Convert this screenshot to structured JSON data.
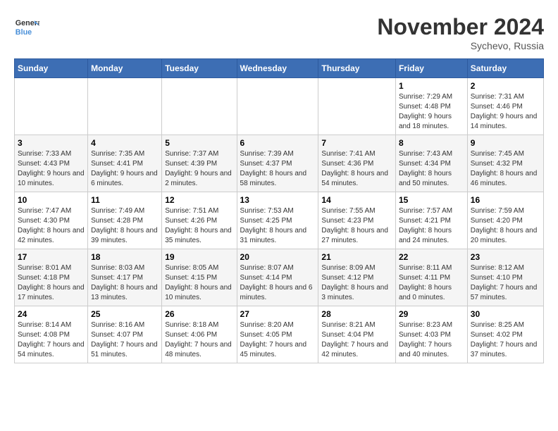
{
  "header": {
    "logo_line1": "General",
    "logo_line2": "Blue",
    "month": "November 2024",
    "location": "Sychevo, Russia"
  },
  "weekdays": [
    "Sunday",
    "Monday",
    "Tuesday",
    "Wednesday",
    "Thursday",
    "Friday",
    "Saturday"
  ],
  "weeks": [
    [
      {
        "day": "",
        "info": ""
      },
      {
        "day": "",
        "info": ""
      },
      {
        "day": "",
        "info": ""
      },
      {
        "day": "",
        "info": ""
      },
      {
        "day": "",
        "info": ""
      },
      {
        "day": "1",
        "info": "Sunrise: 7:29 AM\nSunset: 4:48 PM\nDaylight: 9 hours and 18 minutes."
      },
      {
        "day": "2",
        "info": "Sunrise: 7:31 AM\nSunset: 4:46 PM\nDaylight: 9 hours and 14 minutes."
      }
    ],
    [
      {
        "day": "3",
        "info": "Sunrise: 7:33 AM\nSunset: 4:43 PM\nDaylight: 9 hours and 10 minutes."
      },
      {
        "day": "4",
        "info": "Sunrise: 7:35 AM\nSunset: 4:41 PM\nDaylight: 9 hours and 6 minutes."
      },
      {
        "day": "5",
        "info": "Sunrise: 7:37 AM\nSunset: 4:39 PM\nDaylight: 9 hours and 2 minutes."
      },
      {
        "day": "6",
        "info": "Sunrise: 7:39 AM\nSunset: 4:37 PM\nDaylight: 8 hours and 58 minutes."
      },
      {
        "day": "7",
        "info": "Sunrise: 7:41 AM\nSunset: 4:36 PM\nDaylight: 8 hours and 54 minutes."
      },
      {
        "day": "8",
        "info": "Sunrise: 7:43 AM\nSunset: 4:34 PM\nDaylight: 8 hours and 50 minutes."
      },
      {
        "day": "9",
        "info": "Sunrise: 7:45 AM\nSunset: 4:32 PM\nDaylight: 8 hours and 46 minutes."
      }
    ],
    [
      {
        "day": "10",
        "info": "Sunrise: 7:47 AM\nSunset: 4:30 PM\nDaylight: 8 hours and 42 minutes."
      },
      {
        "day": "11",
        "info": "Sunrise: 7:49 AM\nSunset: 4:28 PM\nDaylight: 8 hours and 39 minutes."
      },
      {
        "day": "12",
        "info": "Sunrise: 7:51 AM\nSunset: 4:26 PM\nDaylight: 8 hours and 35 minutes."
      },
      {
        "day": "13",
        "info": "Sunrise: 7:53 AM\nSunset: 4:25 PM\nDaylight: 8 hours and 31 minutes."
      },
      {
        "day": "14",
        "info": "Sunrise: 7:55 AM\nSunset: 4:23 PM\nDaylight: 8 hours and 27 minutes."
      },
      {
        "day": "15",
        "info": "Sunrise: 7:57 AM\nSunset: 4:21 PM\nDaylight: 8 hours and 24 minutes."
      },
      {
        "day": "16",
        "info": "Sunrise: 7:59 AM\nSunset: 4:20 PM\nDaylight: 8 hours and 20 minutes."
      }
    ],
    [
      {
        "day": "17",
        "info": "Sunrise: 8:01 AM\nSunset: 4:18 PM\nDaylight: 8 hours and 17 minutes."
      },
      {
        "day": "18",
        "info": "Sunrise: 8:03 AM\nSunset: 4:17 PM\nDaylight: 8 hours and 13 minutes."
      },
      {
        "day": "19",
        "info": "Sunrise: 8:05 AM\nSunset: 4:15 PM\nDaylight: 8 hours and 10 minutes."
      },
      {
        "day": "20",
        "info": "Sunrise: 8:07 AM\nSunset: 4:14 PM\nDaylight: 8 hours and 6 minutes."
      },
      {
        "day": "21",
        "info": "Sunrise: 8:09 AM\nSunset: 4:12 PM\nDaylight: 8 hours and 3 minutes."
      },
      {
        "day": "22",
        "info": "Sunrise: 8:11 AM\nSunset: 4:11 PM\nDaylight: 8 hours and 0 minutes."
      },
      {
        "day": "23",
        "info": "Sunrise: 8:12 AM\nSunset: 4:10 PM\nDaylight: 7 hours and 57 minutes."
      }
    ],
    [
      {
        "day": "24",
        "info": "Sunrise: 8:14 AM\nSunset: 4:08 PM\nDaylight: 7 hours and 54 minutes."
      },
      {
        "day": "25",
        "info": "Sunrise: 8:16 AM\nSunset: 4:07 PM\nDaylight: 7 hours and 51 minutes."
      },
      {
        "day": "26",
        "info": "Sunrise: 8:18 AM\nSunset: 4:06 PM\nDaylight: 7 hours and 48 minutes."
      },
      {
        "day": "27",
        "info": "Sunrise: 8:20 AM\nSunset: 4:05 PM\nDaylight: 7 hours and 45 minutes."
      },
      {
        "day": "28",
        "info": "Sunrise: 8:21 AM\nSunset: 4:04 PM\nDaylight: 7 hours and 42 minutes."
      },
      {
        "day": "29",
        "info": "Sunrise: 8:23 AM\nSunset: 4:03 PM\nDaylight: 7 hours and 40 minutes."
      },
      {
        "day": "30",
        "info": "Sunrise: 8:25 AM\nSunset: 4:02 PM\nDaylight: 7 hours and 37 minutes."
      }
    ]
  ]
}
